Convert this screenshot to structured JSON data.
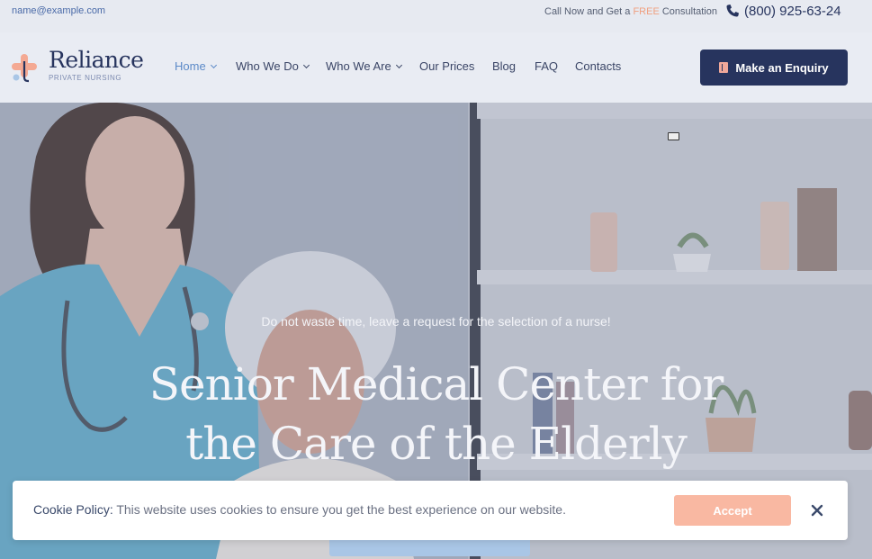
{
  "topbar": {
    "email": "name@example.com",
    "call_prefix": "Call Now and Get a ",
    "call_free": "FREE",
    "call_suffix": " Consultation",
    "phone": "(800) 925-63-24"
  },
  "brand": {
    "name": "Reliance",
    "tagline": "PRIVATE NURSING"
  },
  "nav": {
    "items": [
      {
        "label": "Home",
        "active": true,
        "dropdown": true
      },
      {
        "label": "Who We Do",
        "dropdown": true
      },
      {
        "label": "Who We Are",
        "dropdown": true
      },
      {
        "label": "Our Prices"
      },
      {
        "label": "Blog"
      },
      {
        "label": "FAQ"
      },
      {
        "label": "Contacts"
      }
    ],
    "cta_label": "Make an Enquiry"
  },
  "hero": {
    "subtitle": "Do not waste time, leave a request for the selection of a nurse!",
    "title_line1": "Senior Medical Center for",
    "title_line2": "the Care of the Elderly"
  },
  "cookie": {
    "label": "Cookie Policy:",
    "message": " This website uses cookies to ensure you get the best experience on our website.",
    "accept_label": "Accept"
  },
  "colors": {
    "brand_navy": "#27345e",
    "accent_peach": "#f9b8a2",
    "nav_active": "#5c8ac8"
  }
}
